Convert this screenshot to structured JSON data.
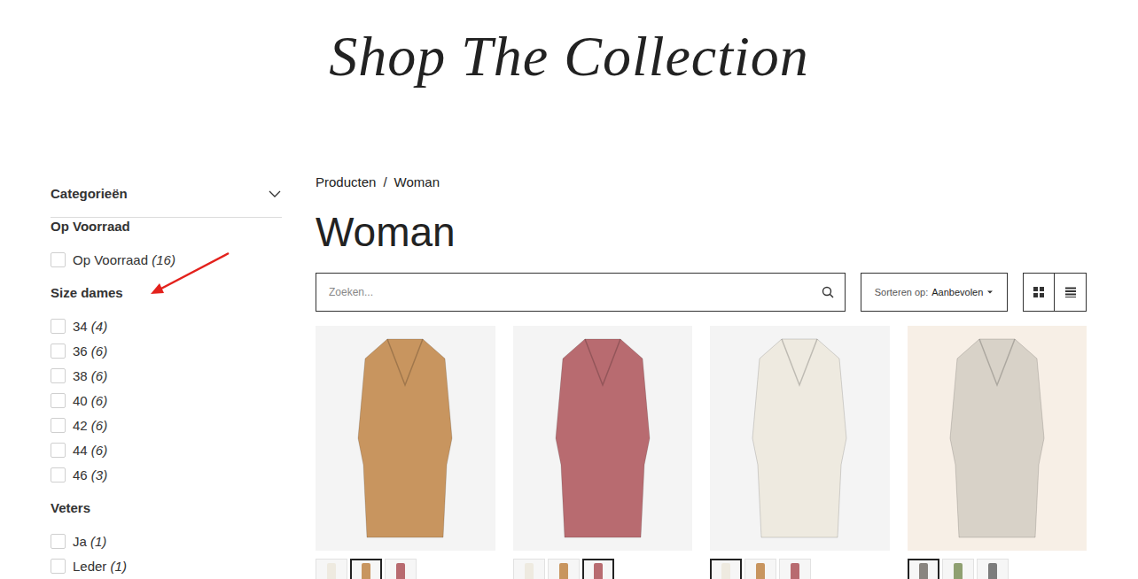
{
  "logo": "Shop The Collection",
  "filters": {
    "categories": {
      "label": "Categorieën",
      "expanded": false
    },
    "groups": [
      {
        "title": "Op Voorraad",
        "options": [
          {
            "label": "Op Voorraad",
            "count": "(16)",
            "checked": false
          }
        ]
      },
      {
        "title": "Size dames",
        "options": [
          {
            "label": "34",
            "count": "(4)",
            "checked": false
          },
          {
            "label": "36",
            "count": "(6)",
            "checked": false
          },
          {
            "label": "38",
            "count": "(6)",
            "checked": false
          },
          {
            "label": "40",
            "count": "(6)",
            "checked": false
          },
          {
            "label": "42",
            "count": "(6)",
            "checked": false
          },
          {
            "label": "44",
            "count": "(6)",
            "checked": false
          },
          {
            "label": "46",
            "count": "(3)",
            "checked": false
          }
        ]
      },
      {
        "title": "Veters",
        "options": [
          {
            "label": "Ja",
            "count": "(1)",
            "checked": false
          },
          {
            "label": "Leder",
            "count": "(1)",
            "checked": false
          }
        ]
      }
    ]
  },
  "breadcrumb": {
    "items": [
      "Producten",
      "Woman"
    ],
    "separator": "/"
  },
  "title": "Woman",
  "search": {
    "placeholder": "Zoeken..."
  },
  "sort": {
    "label": "Sorteren op:",
    "value": "Aanbevolen"
  },
  "views": [
    {
      "kind": "grid"
    },
    {
      "kind": "list"
    }
  ],
  "products": [
    {
      "color": "#c8955f",
      "background": "#f4f4f4",
      "swatches": [
        {
          "color": "#eeeae0",
          "selected": false
        },
        {
          "color": "#c8955f",
          "selected": true
        },
        {
          "color": "#b86b70",
          "selected": false
        }
      ]
    },
    {
      "color": "#b86b70",
      "background": "#f4f4f4",
      "swatches": [
        {
          "color": "#eeeae0",
          "selected": false
        },
        {
          "color": "#c8955f",
          "selected": false
        },
        {
          "color": "#b86b70",
          "selected": true
        }
      ]
    },
    {
      "color": "#eeeae0",
      "background": "#f4f4f4",
      "swatches": [
        {
          "color": "#eeeae0",
          "selected": true
        },
        {
          "color": "#c8955f",
          "selected": false
        },
        {
          "color": "#b86b70",
          "selected": false
        }
      ]
    },
    {
      "color": "#d8d2c8",
      "background": "#f7efe6",
      "swatches": [
        {
          "color": "#8a8580",
          "selected": true
        },
        {
          "color": "#8fa071",
          "selected": false
        },
        {
          "color": "#7c7c7c",
          "selected": false
        }
      ]
    }
  ]
}
